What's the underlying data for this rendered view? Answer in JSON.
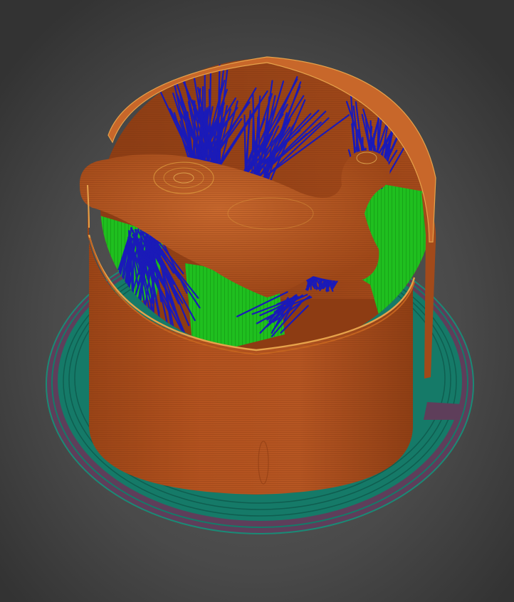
{
  "viewport": {
    "view": "3d-preview",
    "background_colors": {
      "center": "#5a5a5a",
      "edge": "#343434"
    }
  },
  "model": {
    "object": "duck",
    "container": "cylindrical-wall"
  },
  "feature_colors": {
    "perimeter": "#b4531f",
    "perimeter_highlight": "#e0a040",
    "travel": "#1a1ab8",
    "support": "#1fbf1f",
    "brim": "#157a68",
    "first_layer": "#5e3e5a"
  }
}
